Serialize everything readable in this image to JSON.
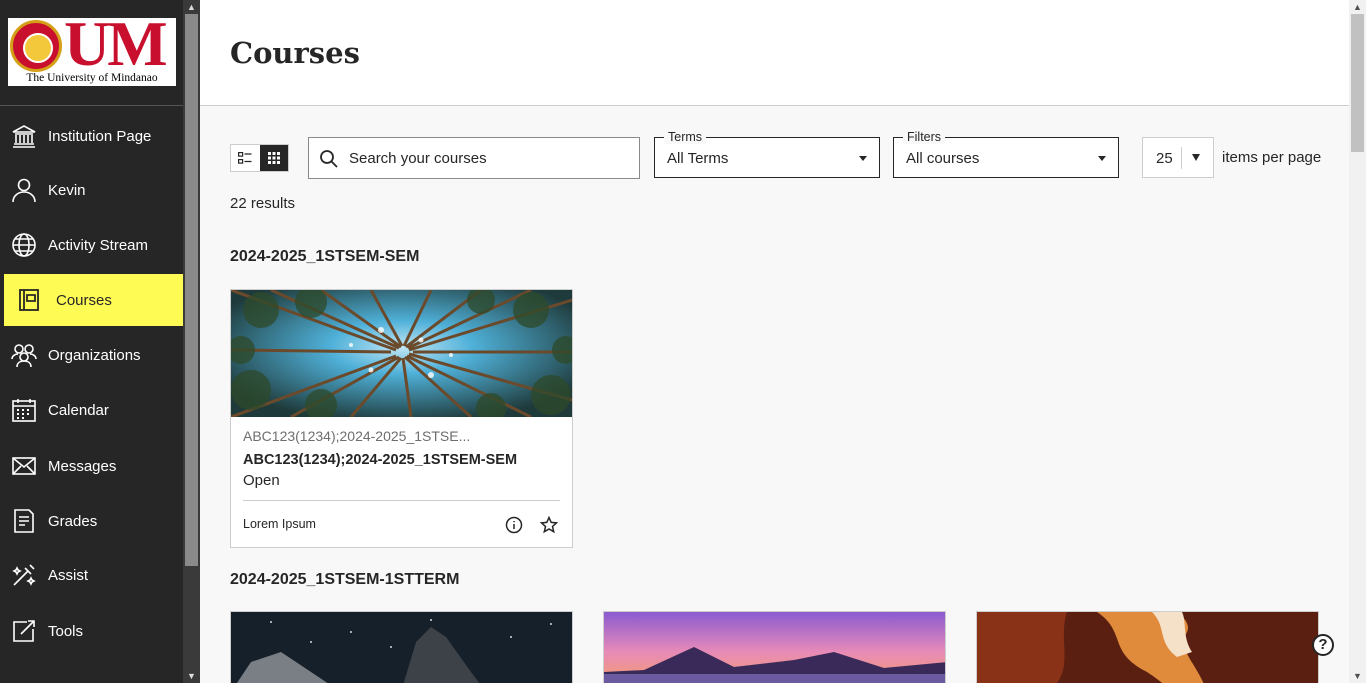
{
  "sidebar": {
    "logo_text": "UM",
    "logo_subtitle": "The University of Mindanao",
    "items": [
      {
        "label": "Institution Page",
        "icon": "institution-icon"
      },
      {
        "label": "Kevin",
        "icon": "user-icon"
      },
      {
        "label": "Activity Stream",
        "icon": "globe-icon"
      },
      {
        "label": "Courses",
        "icon": "courses-icon",
        "active": true
      },
      {
        "label": "Organizations",
        "icon": "organizations-icon"
      },
      {
        "label": "Calendar",
        "icon": "calendar-icon"
      },
      {
        "label": "Messages",
        "icon": "envelope-icon"
      },
      {
        "label": "Grades",
        "icon": "grades-icon"
      },
      {
        "label": "Assist",
        "icon": "assist-icon"
      },
      {
        "label": "Tools",
        "icon": "tools-icon"
      }
    ]
  },
  "header": {
    "title": "Courses"
  },
  "toolbar": {
    "search_placeholder": "Search your courses",
    "terms": {
      "label": "Terms",
      "value": "All Terms"
    },
    "filters": {
      "label": "Filters",
      "value": "All courses"
    },
    "per_page": {
      "value": "25",
      "suffix": "items per page"
    }
  },
  "results_count": "22 results",
  "groups": [
    {
      "term": "2024-2025_1STSEM-SEM",
      "courses": [
        {
          "id": "ABC123(1234);2024-2025_1STSE...",
          "name": "ABC123(1234);2024-2025_1STSEM-SEM",
          "status": "Open",
          "instructor": "Lorem Ipsum"
        }
      ]
    },
    {
      "term": "2024-2025_1STSEM-1STTERM"
    }
  ],
  "colors": {
    "sidebar_bg": "#262626",
    "active_highlight": "#fffb55",
    "logo_red": "#c8102e",
    "content_bg": "#f8f8f8"
  }
}
